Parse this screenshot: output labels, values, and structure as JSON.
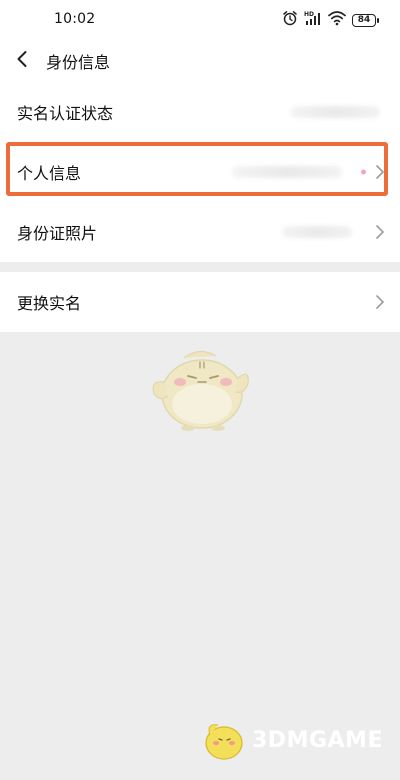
{
  "status_bar": {
    "time": "10:02",
    "battery": "84",
    "icons": [
      "alarm-icon",
      "hd-signal-icon",
      "wifi-icon",
      "battery-icon"
    ]
  },
  "header": {
    "back_icon": "chevron-left-icon",
    "title": "身份信息"
  },
  "sections": [
    {
      "items": [
        {
          "label": "实名认证状态",
          "has_chevron": false
        },
        {
          "label": "个人信息",
          "has_chevron": true,
          "highlighted": true
        },
        {
          "label": "身份证照片",
          "has_chevron": true
        }
      ]
    },
    {
      "items": [
        {
          "label": "更换实名",
          "has_chevron": true
        }
      ]
    }
  ],
  "watermark": {
    "text": "3DMGAME"
  },
  "colors": {
    "background": "#ededed",
    "surface": "#ffffff",
    "highlight": "#ee6b3c"
  }
}
